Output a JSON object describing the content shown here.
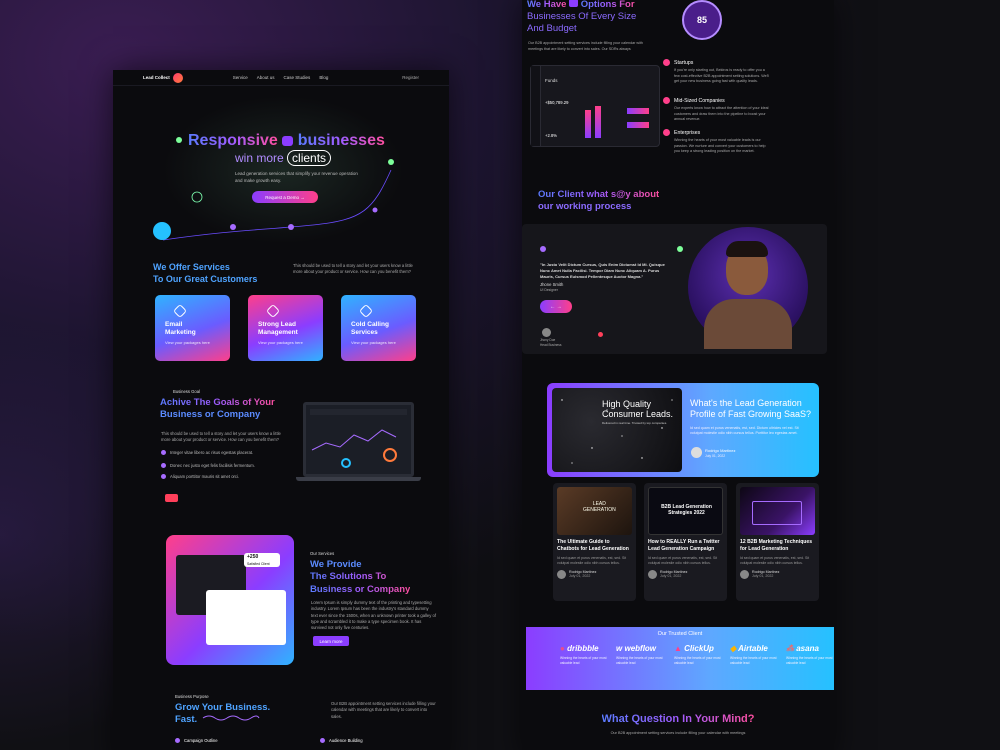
{
  "left": {
    "nav": {
      "logo": "Lead Collect",
      "items": [
        "Service",
        "About us",
        "Case Studies",
        "Blog"
      ],
      "register": "Register"
    },
    "hero": {
      "title_a": "Responsive",
      "title_b": "businesses",
      "subtitle_a": "win more",
      "subtitle_b": "clients",
      "desc": "Lead generation services that simplify your revenue operation and make growth easy.",
      "cta": "Request a Demo →"
    },
    "offer": {
      "title_a": "We Offer Services",
      "title_b": "To Our Great Customers",
      "desc": "This should be used to tell a story and let your users know a little more about your product or service. How can you benefit them?",
      "cards": [
        {
          "title_a": "Email",
          "title_b": "Marketing",
          "sub": "View your packages here"
        },
        {
          "title_a": "Strong Lead",
          "title_b": "Management",
          "sub": "View your packages here"
        },
        {
          "title_a": "Cold Calling",
          "title_b": "Services",
          "sub": "View your packages here"
        }
      ]
    },
    "goals": {
      "kicker": "Business Goal",
      "title_a": "Achive The Goals of Your",
      "title_b": "Business or Company",
      "desc": "This should be used to tell a story and let your users know a little more about your product or service. How can you benefit them?",
      "bullets": [
        "Integer vitae libero ac risus egestas placerat.",
        "Donec nec justo eget felis facilisis fermentum.",
        "Aliquam porttitor mauris sit amet orci."
      ]
    },
    "provide": {
      "kicker": "Our Services",
      "title_a": "We Provide",
      "title_b": "The Solutions To",
      "title_c": "Business or Company",
      "desc": "Lorem Ipsum is simply dummy text of the printing and typesetting industry. Lorem Ipsum has been the industry's standard dummy text ever since the 1500s, when an unknown printer took a galley of type and scrambled it to make a type specimen book. It has survived not only five centuries.",
      "badge_value": "+250",
      "badge_label": "Satisfied Client",
      "cta": "Learn more"
    },
    "grow": {
      "kicker": "Business Purpose",
      "title_a": "Grow Your Business.",
      "title_b": "Fast.",
      "desc": "Our B2B appointment setting services include filling your calendar with meetings that are likely to convert into sales.",
      "items": [
        "Campaign Outline",
        "Audience Building"
      ]
    }
  },
  "right": {
    "options": {
      "title_a": "We Have",
      "title_b": "Options For",
      "title_c": "Businesses Of Every Size",
      "title_d": "And Budget",
      "desc": "Our B2B appointment setting services include filling your calendar with meetings that are likely to convert into sales. Our SDRs always",
      "badge": "85",
      "funds_label": "Funds",
      "funds_value": "+$50,789.29",
      "funds_pct": "+2.8%",
      "items": [
        {
          "title": "Startups",
          "desc": "If you're only starting out, Bekiros is ready to offer you a few cost-effective B2B appointment setting solutions. We'll get your new business going fast with quality leads."
        },
        {
          "title": "Mid-Sized Companies",
          "desc": "Our experts know how to attract the attention of your ideal customers and draw them into the pipeline to boost your annual revenue."
        },
        {
          "title": "Enterprises",
          "desc": "Winning the hearts of your most valuable leads is our passion. We nurture and convert your customers to help you keep a strong leading position on the market."
        }
      ]
    },
    "testimonial": {
      "title_a": "Our Client what s@y about",
      "title_b": "our working process",
      "quote": "\"In Justo Velit Dictum Cursus, Quis Enim Dictumst Id Mi. Quisque Nunc Amet Nulla Facilisi. Tempor Diam Nunc Aliquam A. Purus Mauris, Cursus Euismod Pellentesque Auctor Magna.\"",
      "name": "Jhone Smith",
      "role": "UI Designer",
      "mini_name": "Jhony Doe",
      "mini_role": "Head Business"
    },
    "lead": {
      "img_title_a": "High Quality",
      "img_title_b": "Consumer Leads.",
      "img_sub": "Delivered in real time. Trusted by top companies.",
      "title_a": "What's the Lead Generation",
      "title_b": "Profile of Fast Growing SaaS?",
      "desc": "Id sed quam et purus venenatis, est, sed. Dictum ultricies vel est. Sit volutpat molestie odio nibh cursus tellus. Porttitor leo egestas amet.",
      "author": "Rodrigo Martinez",
      "date": "July 01, 2022"
    },
    "blogs": [
      {
        "img_text_a": "LEAD",
        "img_text_b": "GENERATION",
        "title": "The Ultimate Guide to Chatbots for Lead Generation",
        "desc": "Id sed quam et purus venenatis, est, sed. Sit volutpat molestie odio nibh cursus tellus.",
        "author": "Rodrigo Martinez",
        "date": "July 01, 2022"
      },
      {
        "img_text_a": "B2B Lead Generation",
        "img_text_b": "Strategies 2022",
        "title": "How to REALLY Run a Twitter Lead Generation Campaign",
        "desc": "Id sed quam et purus venenatis, est, sed. Sit volutpat molestie odio nibh cursus tellus.",
        "author": "Rodrigo Martinez",
        "date": "July 01, 2022"
      },
      {
        "img_text_a": "",
        "img_text_b": "",
        "title": "12 B2B Marketing Techniques for Lead Generation",
        "desc": "Id sed quam et purus venenatis, est, sed. Sit volutpat molestie odio nibh cursus tellus.",
        "author": "Rodrigo Martinez",
        "date": "July 01, 2022"
      }
    ],
    "trusted": {
      "title": "Our Trusted Client",
      "clients": [
        {
          "name": "dribbble",
          "desc": "Winning the hearts of your most valuable lead"
        },
        {
          "name": "webflow",
          "desc": "Winning the hearts of your most valuable lead"
        },
        {
          "name": "ClickUp",
          "desc": "Winning the hearts of your most valuable lead"
        },
        {
          "name": "Airtable",
          "desc": "Winning the hearts of your most valuable lead"
        },
        {
          "name": "asana",
          "desc": "Winning the hearts of your most valuable lead"
        }
      ]
    },
    "faq": {
      "title": "What Question In Your Mind?",
      "desc": "Our B2B appointment setting services include filling your calendar with meetings"
    }
  },
  "colors": {
    "accent_purple": "#8b3dff",
    "accent_pink": "#ff3f8a",
    "accent_blue": "#25c1ff",
    "background": "#0b0b0e"
  }
}
